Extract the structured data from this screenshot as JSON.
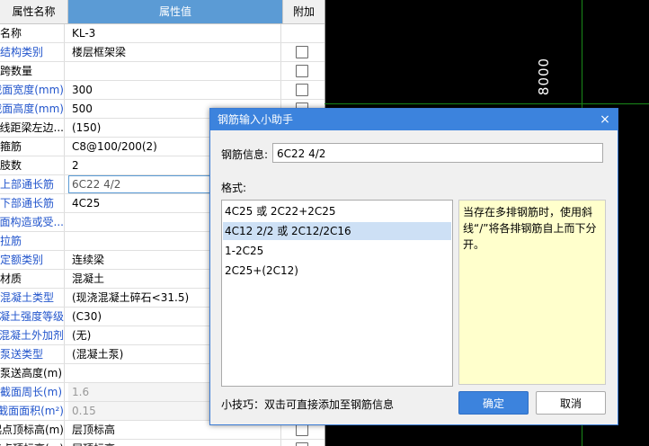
{
  "table": {
    "headers": {
      "name": "属性名称",
      "value": "属性值",
      "extra": "附加"
    },
    "rows": [
      {
        "name": "名称",
        "value": "KL-3",
        "checkbox": false,
        "blue": false,
        "style": ""
      },
      {
        "name": "结构类别",
        "value": "楼层框架梁",
        "checkbox": true,
        "blue": true,
        "style": ""
      },
      {
        "name": "跨数量",
        "value": "",
        "checkbox": true,
        "blue": false,
        "style": ""
      },
      {
        "name": "截面宽度(mm)",
        "value": "300",
        "checkbox": true,
        "blue": true,
        "style": ""
      },
      {
        "name": "截面高度(mm)",
        "value": "500",
        "checkbox": true,
        "blue": true,
        "style": ""
      },
      {
        "name": "轴线距梁左边...",
        "value": "(150)",
        "checkbox": true,
        "blue": false,
        "style": ""
      },
      {
        "name": "箍筋",
        "value": "C8@100/200(2)",
        "checkbox": true,
        "blue": false,
        "style": ""
      },
      {
        "name": "肢数",
        "value": "2",
        "checkbox": false,
        "blue": false,
        "style": ""
      },
      {
        "name": "上部通长筋",
        "value": "6C22 4/2",
        "checkbox": false,
        "blue": true,
        "style": "edit"
      },
      {
        "name": "下部通长筋",
        "value": "4C25",
        "checkbox": false,
        "blue": true,
        "style": ""
      },
      {
        "name": "侧面构造或受...",
        "value": "",
        "checkbox": false,
        "blue": true,
        "style": ""
      },
      {
        "name": "拉筋",
        "value": "",
        "checkbox": false,
        "blue": true,
        "style": ""
      },
      {
        "name": "定额类别",
        "value": "连续梁",
        "checkbox": false,
        "blue": true,
        "style": ""
      },
      {
        "name": "材质",
        "value": "混凝土",
        "checkbox": false,
        "blue": false,
        "style": ""
      },
      {
        "name": "混凝土类型",
        "value": "(现浇混凝土碎石<31.5)",
        "checkbox": false,
        "blue": true,
        "style": ""
      },
      {
        "name": "混凝土强度等级",
        "value": "(C30)",
        "checkbox": false,
        "blue": true,
        "style": ""
      },
      {
        "name": "混凝土外加剂",
        "value": "(无)",
        "checkbox": false,
        "blue": true,
        "style": ""
      },
      {
        "name": "泵送类型",
        "value": "(混凝土泵)",
        "checkbox": false,
        "blue": true,
        "style": ""
      },
      {
        "name": "泵送高度(m)",
        "value": "",
        "checkbox": false,
        "blue": false,
        "style": ""
      },
      {
        "name": "截面周长(m)",
        "value": "1.6",
        "checkbox": true,
        "blue": true,
        "style": "gray"
      },
      {
        "name": "截面面积(m²)",
        "value": "0.15",
        "checkbox": true,
        "blue": true,
        "style": "gray"
      },
      {
        "name": "起点顶标高(m)",
        "value": "层顶标高",
        "checkbox": true,
        "blue": false,
        "style": ""
      },
      {
        "name": "终点顶标高(m)",
        "value": "层顶标高",
        "checkbox": true,
        "blue": false,
        "style": ""
      }
    ]
  },
  "canvas": {
    "dimension_label": "8000",
    "line_color": "#1a8a1a"
  },
  "dialog": {
    "title": "钢筋输入小助手",
    "close_glyph": "×",
    "info_label": "钢筋信息:",
    "info_value": "6C22 4/2",
    "format_label": "格式:",
    "formats": [
      "4C25 或 2C22+2C25",
      "4C12 2/2 或 2C12/2C16",
      "1-2C25",
      "2C25+(2C12)"
    ],
    "selected_index": 1,
    "hint": "当存在多排钢筋时，使用斜线“/”将各排钢筋自上而下分开。",
    "tip": "小技巧：双击可直接添加至钢筋信息",
    "ok_label": "确定",
    "cancel_label": "取消",
    "accent_color": "#3c83dd"
  }
}
